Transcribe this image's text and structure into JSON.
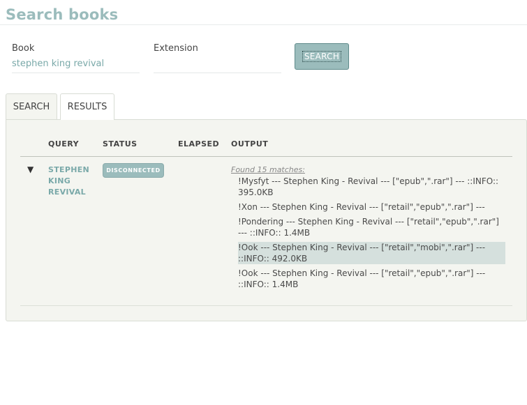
{
  "page": {
    "title": "Search books"
  },
  "form": {
    "book_label": "Book",
    "book_value": "stephen king revival",
    "extension_label": "Extension",
    "extension_value": "",
    "search_button": "SEARCH"
  },
  "tabs": [
    {
      "label": "SEARCH",
      "active": false
    },
    {
      "label": "RESULTS",
      "active": true
    }
  ],
  "table": {
    "headers": {
      "query": "QUERY",
      "status": "STATUS",
      "elapsed": "ELAPSED",
      "output": "OUTPUT"
    },
    "rows": [
      {
        "toggle": "▼",
        "query": "STEPHEN KING REVIVAL",
        "status": "DISCONNECTED",
        "elapsed": "",
        "found": "Found 15 matches:",
        "outputs": [
          "!Mysfyt --- Stephen King - Revival --- [\"epub\",\".rar\"] --- ::INFO:: 395.0KB",
          "!Xon --- Stephen King - Revival --- [\"retail\",\"epub\",\".rar\"] ---",
          "!Pondering --- Stephen King - Revival --- [\"retail\",\"epub\",\".rar\"] --- ::INFO:: 1.4MB",
          "!Ook --- Stephen King - Revival --- [\"retail\",\"mobi\",\".rar\"] --- ::INFO:: 492.0KB",
          "!Ook --- Stephen King - Revival --- [\"retail\",\"epub\",\".rar\"] --- ::INFO:: 1.4MB"
        ],
        "highlighted_output": 3
      }
    ]
  },
  "colors": {
    "accent": "#9bbcbc",
    "accent_text": "#7aa9a9",
    "panel_bg": "#f4f5f0",
    "highlight_bg": "#d5e0dd"
  }
}
